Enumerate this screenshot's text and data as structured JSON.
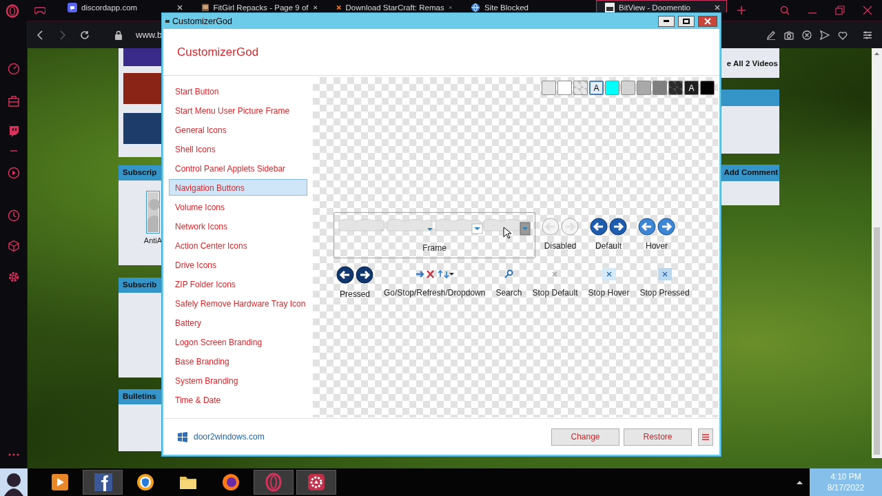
{
  "browser": {
    "tabs": [
      {
        "kind": "chat",
        "title": "discordapp.com",
        "selected": false,
        "close_button": true
      },
      {
        "kind": "photo",
        "title": "FitGirl Repacks - Page 9 of",
        "selected": false,
        "close_button": true
      },
      {
        "kind": "x-logo",
        "title": "Download StarCraft: Remas",
        "selected": false,
        "close_button": true
      },
      {
        "kind": "globe",
        "title": "Site Blocked",
        "selected": false,
        "close_button": false
      },
      {
        "kind": "square-logo",
        "title": "BitView - Doomentio",
        "selected": true,
        "close_button": true
      }
    ],
    "address": "www.b"
  },
  "page": {
    "left_column": [
      {
        "kind": "thumbnails"
      },
      {
        "kind": "panel",
        "heading": "Subscrip",
        "members": [
          "AntiA"
        ]
      },
      {
        "kind": "panel",
        "heading": "Subscrib"
      },
      {
        "kind": "panel",
        "heading": "Bulletins"
      }
    ],
    "right_column": [
      {
        "kind": "link-panel",
        "text": "e All 2 Videos"
      },
      {
        "kind": "panel"
      },
      {
        "kind": "panel",
        "heading": "Add Comment"
      }
    ]
  },
  "window": {
    "title": "CustomizerGod",
    "heading": "CustomizerGod",
    "categories": [
      {
        "label": "Start Button",
        "selected": false
      },
      {
        "label": "Start Menu User Picture Frame",
        "selected": false
      },
      {
        "label": "General Icons",
        "selected": false
      },
      {
        "label": "Shell Icons",
        "selected": false
      },
      {
        "label": "Control Panel Applets Sidebar",
        "selected": false
      },
      {
        "label": "Navigation Buttons",
        "selected": true
      },
      {
        "label": "Volume Icons",
        "selected": false
      },
      {
        "label": "Network Icons",
        "selected": false
      },
      {
        "label": "Action Center Icons",
        "selected": false
      },
      {
        "label": "Drive Icons",
        "selected": false
      },
      {
        "label": "ZIP Folder Icons",
        "selected": false
      },
      {
        "label": "Safely Remove Hardware Tray Icon",
        "selected": false
      },
      {
        "label": "Battery",
        "selected": false
      },
      {
        "label": "Logon Screen Branding",
        "selected": false
      },
      {
        "label": "Base Branding",
        "selected": false
      },
      {
        "label": "System Branding",
        "selected": false
      },
      {
        "label": "Time & Date",
        "selected": false
      }
    ],
    "swatches": [
      {
        "kind": "solid",
        "color": "#e4e4e4",
        "selected": false
      },
      {
        "kind": "solid",
        "color": "#ffffff",
        "selected": false
      },
      {
        "kind": "checker",
        "color": "#e6e6e6",
        "selected": false
      },
      {
        "kind": "letter",
        "color": "#e3edf6",
        "label": "A",
        "selected": true
      },
      {
        "kind": "solid",
        "color": "#00ffff",
        "selected": false
      },
      {
        "kind": "solid",
        "color": "#d2d2d2",
        "selected": false
      },
      {
        "kind": "solid",
        "color": "#a9a9a9",
        "selected": false
      },
      {
        "kind": "solid",
        "color": "#7f7f7f",
        "selected": false
      },
      {
        "kind": "checker",
        "color": "#2b2b2b",
        "selected": false
      },
      {
        "kind": "letter",
        "color": "#1e1e1e",
        "label": "A",
        "selected": false
      },
      {
        "kind": "solid",
        "color": "#000000",
        "selected": false
      }
    ],
    "preview_rows": [
      [
        {
          "kind": "frame",
          "label": "Frame"
        },
        {
          "kind": "nav-grey",
          "label": "Disabled"
        },
        {
          "kind": "nav-blue",
          "label": "Default"
        },
        {
          "kind": "nav-bright",
          "label": "Hover"
        }
      ],
      [
        {
          "kind": "nav-deep",
          "label": "Pressed"
        },
        {
          "kind": "toolbar",
          "label": "Go/Stop/Refresh/Dropdown"
        },
        {
          "kind": "search",
          "label": "Search"
        },
        {
          "kind": "stop-plain",
          "label": "Stop Default"
        },
        {
          "kind": "stop-tinted",
          "label": "Stop Hover"
        },
        {
          "kind": "stop-shaded",
          "label": "Stop Pressed"
        }
      ]
    ],
    "footer": {
      "link": "door2windows.com",
      "buttons": [
        "Change",
        "Restore"
      ]
    }
  },
  "taskbar": {
    "apps": [
      {
        "kind": "media",
        "active": false
      },
      {
        "kind": "facebook",
        "active": true
      },
      {
        "kind": "shield-browser",
        "active": false
      },
      {
        "kind": "folder",
        "active": false
      },
      {
        "kind": "firefox",
        "active": false
      },
      {
        "kind": "opera",
        "active": true
      },
      {
        "kind": "gear",
        "active": true
      }
    ],
    "time": "4:10 PM",
    "date": "8/17/2022"
  }
}
